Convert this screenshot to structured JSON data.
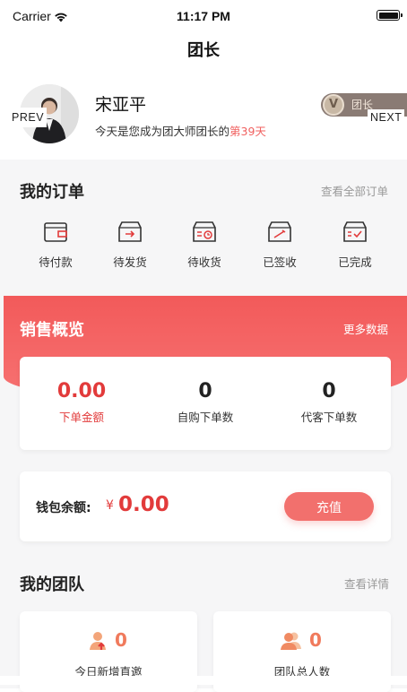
{
  "status_bar": {
    "carrier": "Carrier",
    "time": "11:17 PM"
  },
  "nav": {
    "title": "团长"
  },
  "profile": {
    "name": "宋亚平",
    "sub_prefix": "今天是您成为团大师团长的",
    "sub_highlight": "第39天",
    "badge_text": "团长",
    "prev_label": "PREV",
    "next_label": "NEXT"
  },
  "orders": {
    "title": "我的订单",
    "view_all": "查看全部订单",
    "items": [
      {
        "label": "待付款",
        "icon": "wallet-icon"
      },
      {
        "label": "待发货",
        "icon": "box-ship-icon"
      },
      {
        "label": "待收货",
        "icon": "box-clock-icon"
      },
      {
        "label": "已签收",
        "icon": "box-sign-icon"
      },
      {
        "label": "已完成",
        "icon": "box-check-icon"
      }
    ]
  },
  "sales": {
    "title": "销售概览",
    "more": "更多数据",
    "stats": [
      {
        "value": "0.00",
        "label": "下单金额",
        "color": "#e23b3b"
      },
      {
        "value": "0",
        "label": "自购下单数",
        "color": "#222222"
      },
      {
        "value": "0",
        "label": "代客下单数",
        "color": "#222222"
      }
    ]
  },
  "wallet": {
    "label": "钱包余额:",
    "currency": "¥",
    "amount": "0.00",
    "recharge": "充值"
  },
  "team": {
    "title": "我的团队",
    "view_details": "查看详情",
    "cards": [
      {
        "count": "0",
        "label": "今日新增直邀",
        "icon": "user-up-icon"
      },
      {
        "count": "0",
        "label": "团队总人数",
        "icon": "users-icon"
      }
    ]
  },
  "colors": {
    "accent": "#f25a5a",
    "highlight": "#f0605f",
    "badge": "#8a7b74"
  }
}
